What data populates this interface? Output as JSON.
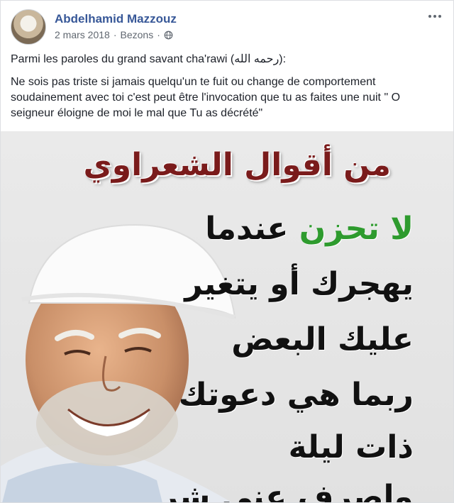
{
  "post": {
    "author": "Abdelhamid Mazzouz",
    "date": "2 mars 2018",
    "separator": "·",
    "location": "Bezons",
    "separator2": "·",
    "privacy_icon": "globe-icon",
    "options_icon": "more-options-icon",
    "text_line1": "Parmi les paroles du grand savant cha'rawi (رحمه الله):",
    "text_line2": "Ne sois pas triste si jamais quelqu'un te fuit ou change de comportement soudainement avec toi c'est peut être l'invocation que tu as faites une nuit \" O seigneur éloigne de moi le mal que Tu as décrété\""
  },
  "image": {
    "title": "من أقوال الشعراوي",
    "line1_green": "لا تحزن",
    "line1_rest": "عندما",
    "line2": "يهجرك أو يتغير",
    "line3": "عليك البعض",
    "line4": "ربما هي دعوتك",
    "line5": "ذات ليلة",
    "line6": "واصرف عني شر",
    "colors": {
      "title": "#7a1b1b",
      "accent_green": "#2e9b2e",
      "text": "#111111"
    }
  }
}
